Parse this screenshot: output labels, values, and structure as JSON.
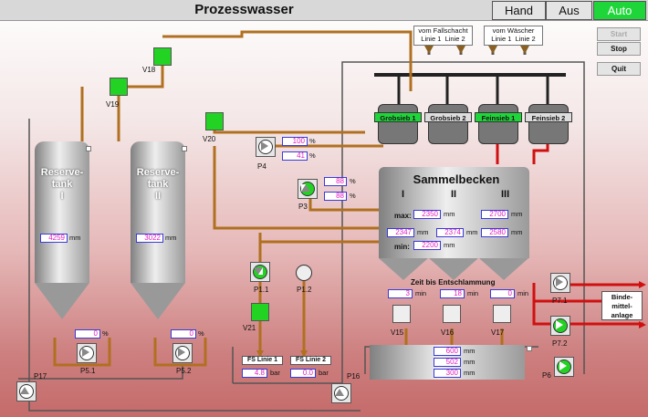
{
  "title": "Prozesswasser",
  "modes": {
    "manual": "Hand",
    "off": "Aus",
    "auto": "Auto"
  },
  "side_buttons": {
    "start": "Start",
    "stop": "Stop",
    "quit": "Quit"
  },
  "sources": {
    "fallschacht": {
      "title": "vom Fallschacht",
      "l1": "Linie 1",
      "l2": "Linie 2"
    },
    "waescher": {
      "title": "vom Wäscher",
      "l1": "Linie 1",
      "l2": "Linie 2"
    }
  },
  "reserve1": {
    "label": "Reserve-\ntank\nI",
    "level": "4259",
    "unit": "mm",
    "pct": "0",
    "pct_unit": "%"
  },
  "reserve2": {
    "label": "Reserve-\ntank\nII",
    "level": "3022",
    "unit": "mm",
    "pct": "0",
    "pct_unit": "%"
  },
  "sieves": [
    {
      "label": "Grobsieb 1",
      "active": true
    },
    {
      "label": "Grobsieb 2",
      "active": false
    },
    {
      "label": "Feinsieb 1",
      "active": true
    },
    {
      "label": "Feinsieb 2",
      "active": false
    }
  ],
  "sammel": {
    "title": "Sammelbecken",
    "cols": [
      "I",
      "II",
      "III"
    ],
    "max_label": "max:",
    "min_label": "min:",
    "max": "2350",
    "v1": "2347",
    "v2": "2374",
    "min": "2200",
    "v3_top": "2700",
    "v3": "2580",
    "unit": "mm",
    "zeit_label": "Zeit bis Entschlammung",
    "zeit": [
      "3",
      "18",
      "0"
    ],
    "zeit_unit": "min"
  },
  "p4": {
    "label": "P4",
    "v1": "100",
    "v2": "41",
    "unit": "%"
  },
  "p3": {
    "label": "P3",
    "v1": "88",
    "v2": "88",
    "unit": "%"
  },
  "pumps": {
    "p11": "P1.1",
    "p12": "P1.2",
    "p17": "P17",
    "p51": "P5.1",
    "p52": "P5.2",
    "p16": "P16",
    "p71": "P7.1",
    "p72": "P7.2",
    "p6": "P6"
  },
  "valves": {
    "v18": "V18",
    "v19": "V19",
    "v20": "V20",
    "v21": "V21",
    "v15": "V15",
    "v16": "V16",
    "v17": "V17"
  },
  "fs1": {
    "label": "FS Linie 1",
    "value": "4.8",
    "unit": "bar"
  },
  "fs2": {
    "label": "FS Linie 2",
    "value": "0.0",
    "unit": "bar"
  },
  "bottom_tank": {
    "v1": "600",
    "v2": "502",
    "v3": "300",
    "unit": "mm"
  },
  "binde": {
    "label": "Binde-\nmittel-\nanlage"
  },
  "colors": {
    "pipe_brown": "#b07020",
    "pipe_red": "#d01010",
    "active_green": "#1fd63a",
    "value_text": "#e020c0",
    "value_border": "#3a3ad8"
  }
}
